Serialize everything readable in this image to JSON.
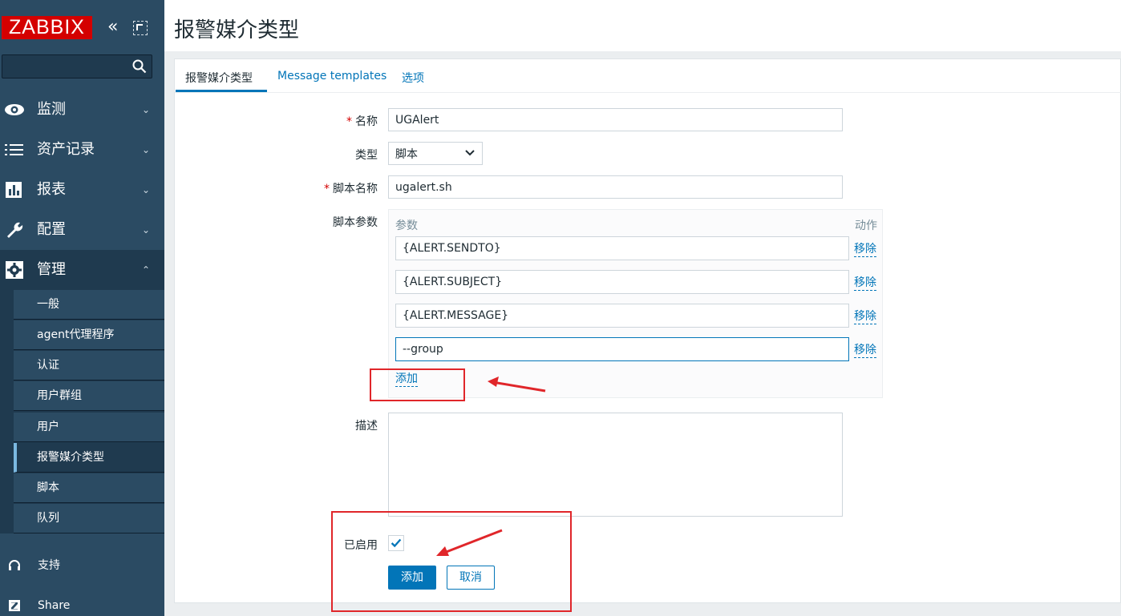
{
  "sidebar": {
    "logo": "ZABBIX",
    "collapse_glyph": "«",
    "search": {
      "placeholder": ""
    },
    "nav": [
      {
        "label": "监测",
        "icon": "eye-icon",
        "expanded": false
      },
      {
        "label": "资产记录",
        "icon": "list-icon",
        "expanded": false
      },
      {
        "label": "报表",
        "icon": "bar-chart-icon",
        "expanded": false
      },
      {
        "label": "配置",
        "icon": "wrench-icon",
        "expanded": false
      },
      {
        "label": "管理",
        "icon": "gear-icon",
        "expanded": true
      }
    ],
    "submenu": [
      {
        "label": "一般"
      },
      {
        "label": "agent代理程序"
      },
      {
        "label": "认证"
      },
      {
        "label": "用户群组"
      },
      {
        "label": "用户"
      },
      {
        "label": "报警媒介类型",
        "selected": true
      },
      {
        "label": "脚本"
      },
      {
        "label": "队列"
      }
    ],
    "bottom": [
      {
        "label": "支持",
        "icon": "headset-icon"
      },
      {
        "label": "Share",
        "icon": "zabbix-share-icon"
      }
    ]
  },
  "header": {
    "title": "报警媒介类型"
  },
  "tabs": [
    {
      "label": "报警媒介类型",
      "active": true
    },
    {
      "label": "Message templates",
      "active": false
    },
    {
      "label": "选项",
      "active": false
    }
  ],
  "form": {
    "name": {
      "label": "名称",
      "required": true,
      "value": "UGAlert"
    },
    "type": {
      "label": "类型",
      "value": "脚本"
    },
    "script_name": {
      "label": "脚本名称",
      "required": true,
      "value": "ugalert.sh"
    },
    "script_params": {
      "label": "脚本参数",
      "col_param": "参数",
      "col_action": "动作",
      "rows": [
        {
          "value": "{ALERT.SENDTO}",
          "action": "移除"
        },
        {
          "value": "{ALERT.SUBJECT}",
          "action": "移除"
        },
        {
          "value": "{ALERT.MESSAGE}",
          "action": "移除"
        },
        {
          "value": "--group",
          "action": "移除"
        }
      ],
      "add_label": "添加"
    },
    "description": {
      "label": "描述",
      "value": ""
    },
    "enabled": {
      "label": "已启用",
      "checked": true
    },
    "submit_label": "添加",
    "cancel_label": "取消"
  },
  "colors": {
    "sidebar_bg": "#2b4b63",
    "accent": "#0275b8",
    "logo_red": "#d40000",
    "annotation_red": "#e0262a"
  }
}
